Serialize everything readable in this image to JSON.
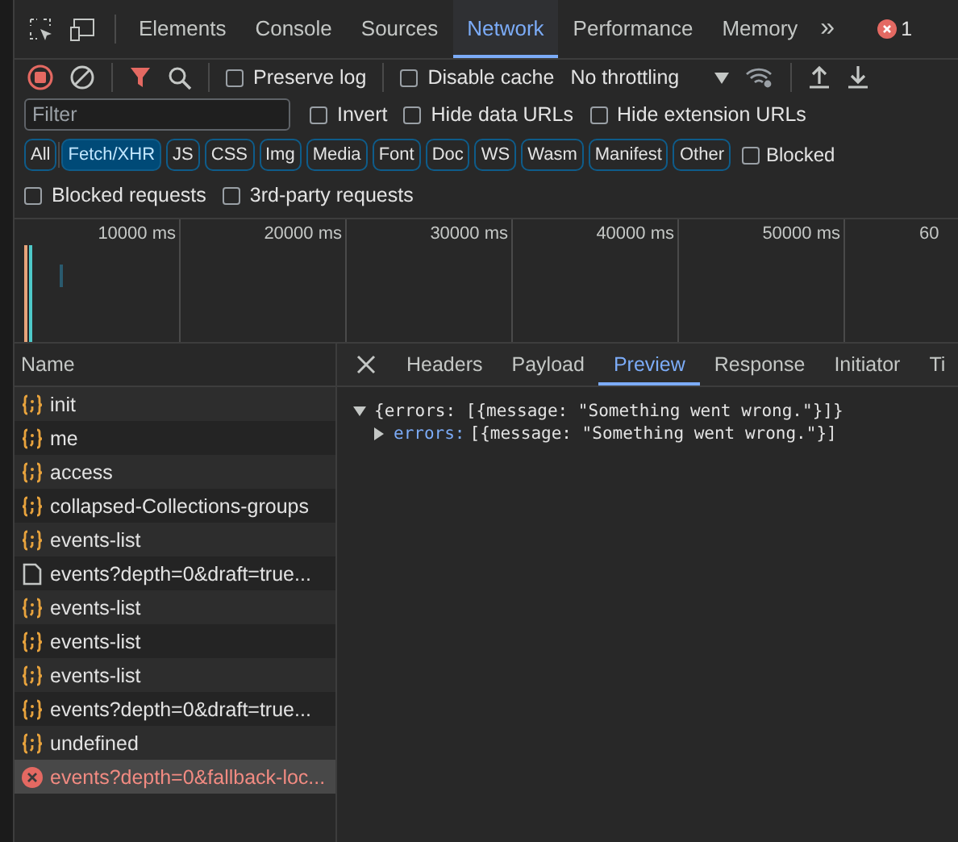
{
  "panel_tabs": [
    {
      "label": "Elements",
      "selected": false
    },
    {
      "label": "Console",
      "selected": false
    },
    {
      "label": "Sources",
      "selected": false
    },
    {
      "label": "Network",
      "selected": true
    },
    {
      "label": "Performance",
      "selected": false
    },
    {
      "label": "Memory",
      "selected": false
    }
  ],
  "more_tabs": "»",
  "error_count": "1",
  "toolbar": {
    "recording": true,
    "preserve_log": {
      "label": "Preserve log",
      "checked": false
    },
    "disable_cache": {
      "label": "Disable cache",
      "checked": false
    },
    "throttling": "No throttling"
  },
  "filter": {
    "placeholder": "Filter",
    "options": [
      {
        "label": "Invert",
        "checked": false
      },
      {
        "label": "Hide data URLs",
        "checked": false
      },
      {
        "label": "Hide extension URLs",
        "checked": false
      }
    ]
  },
  "type_filters": [
    {
      "label": "All",
      "selected": false
    },
    {
      "label": "Fetch/XHR",
      "selected": true
    },
    {
      "label": "JS",
      "selected": false
    },
    {
      "label": "CSS",
      "selected": false
    },
    {
      "label": "Img",
      "selected": false
    },
    {
      "label": "Media",
      "selected": false
    },
    {
      "label": "Font",
      "selected": false
    },
    {
      "label": "Doc",
      "selected": false
    },
    {
      "label": "WS",
      "selected": false
    },
    {
      "label": "Wasm",
      "selected": false
    },
    {
      "label": "Manifest",
      "selected": false
    },
    {
      "label": "Other",
      "selected": false
    }
  ],
  "blocked_option": {
    "label": "Blocked",
    "checked": false
  },
  "request_options": [
    {
      "label": "Blocked requests",
      "checked": false
    },
    {
      "label": "3rd-party requests",
      "checked": false
    }
  ],
  "timeline": {
    "ticks": [
      "10000 ms",
      "20000 ms",
      "30000 ms",
      "40000 ms",
      "50000 ms",
      "60"
    ]
  },
  "requests": {
    "column": "Name",
    "rows": [
      {
        "name": "init",
        "kind": "fetch",
        "selected": false
      },
      {
        "name": "me",
        "kind": "fetch",
        "selected": false
      },
      {
        "name": "access",
        "kind": "fetch",
        "selected": false
      },
      {
        "name": "collapsed-Collections-groups",
        "kind": "fetch",
        "selected": false
      },
      {
        "name": "events-list",
        "kind": "fetch",
        "selected": false
      },
      {
        "name": "events?depth=0&draft=true...",
        "kind": "document",
        "selected": false
      },
      {
        "name": "events-list",
        "kind": "fetch",
        "selected": false
      },
      {
        "name": "events-list",
        "kind": "fetch",
        "selected": false
      },
      {
        "name": "events-list",
        "kind": "fetch",
        "selected": false
      },
      {
        "name": "events?depth=0&draft=true...",
        "kind": "fetch",
        "selected": false
      },
      {
        "name": "undefined",
        "kind": "fetch",
        "selected": false
      },
      {
        "name": "events?depth=0&fallback-loc...",
        "kind": "error",
        "selected": true
      }
    ]
  },
  "detail_tabs": [
    {
      "label": "Headers",
      "selected": false
    },
    {
      "label": "Payload",
      "selected": false
    },
    {
      "label": "Preview",
      "selected": true
    },
    {
      "label": "Response",
      "selected": false
    },
    {
      "label": "Initiator",
      "selected": false
    },
    {
      "label": "Ti",
      "selected": false
    }
  ],
  "preview": {
    "summary": "{errors: [{message: \"Something went wrong.\"}]}",
    "expanded": true,
    "children": [
      {
        "key": "errors:",
        "value": "[{message: \"Something went wrong.\"}]",
        "expanded": false
      }
    ]
  }
}
